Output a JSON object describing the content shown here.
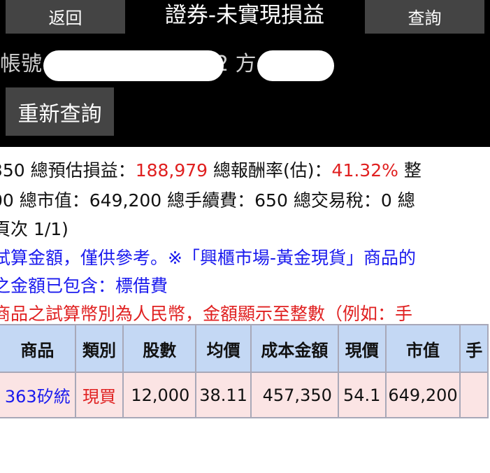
{
  "header": {
    "back_label": "返回",
    "title": "證券-未實現損益",
    "query_label": "查詢",
    "account_label": "帳號",
    "account_suffix": "2 方",
    "requery_label": "重新查詢"
  },
  "summary": {
    "row1": {
      "lead": "350",
      "est_pl_label": "總預估損益：",
      "est_pl_value": "188,979",
      "return_label": "總報酬率(估)：",
      "return_value": "41.32%",
      "tail": "整"
    },
    "row2": {
      "lead": "00",
      "market_value_label": "總市值：",
      "market_value": "649,200",
      "fee_label": "總手續費：",
      "fee_value": "650",
      "tax_label": "總交易稅：",
      "tax_value": "0",
      "tail": "總"
    },
    "page": "頁次 1/1)",
    "notes": {
      "note1": "試算金額，僅供參考。※「興櫃市場-黃金現貨」商品的",
      "note2": "之金額已包含：標借費",
      "note3": "商品之試算幣別為人民幣，金額顯示至整數（例如：手"
    }
  },
  "table": {
    "headers": [
      "商品",
      "類別",
      "股數",
      "均價",
      "成本金額",
      "現價",
      "市值",
      "手"
    ],
    "rows": [
      [
        "363矽統",
        "現買",
        "12,000",
        "38.11",
        "457,350",
        "54.1",
        "649,200",
        ""
      ]
    ]
  },
  "colors": {
    "header_bg": "#000000",
    "button_bg": "#444444",
    "emphasis_red": "#e02020",
    "link_blue": "#1a1aee",
    "table_head_bg": "#c4d8f4",
    "table_row_bg": "#fbe4e4"
  }
}
